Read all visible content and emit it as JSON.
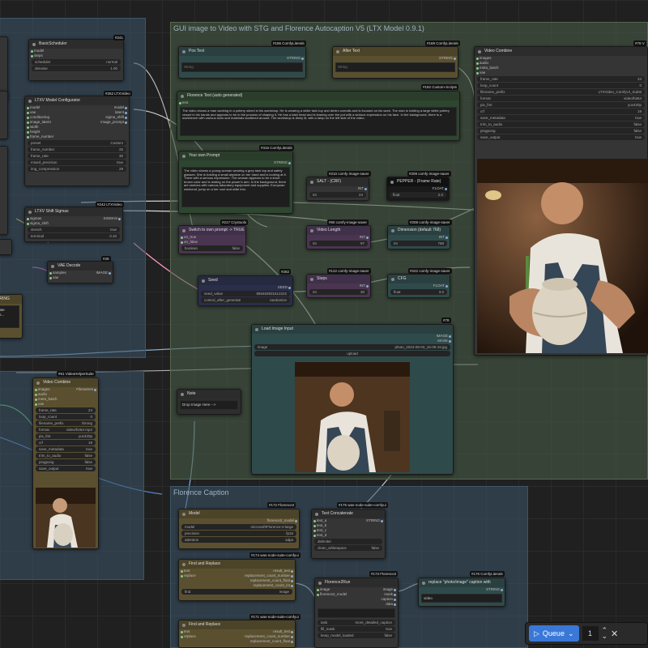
{
  "groups": {
    "autocaption": "GUI image to Video with STG and Florence Autocaption V5 (LTX Model 0.9.1)",
    "florence": "Florence Caption"
  },
  "nodes": {
    "basic_scheduler": {
      "badge": "#241",
      "title": "BasicScheduler",
      "slots": [
        "model",
        "steps",
        "scheduler",
        "sigmas"
      ],
      "widgets": [
        [
          "scheduler",
          "normal"
        ],
        [
          "denoise",
          "1.00"
        ]
      ]
    },
    "ltxv_config": {
      "badge": "#252 LTXVideo",
      "title": "LTXV Model Configurator",
      "inputs": [
        "model",
        "vae",
        "conditioning",
        "image_latent",
        "width",
        "height",
        "frame_number",
        "img_compression"
      ],
      "outputs": [
        "model",
        "latent",
        "sigma_shift",
        "image_prompt"
      ],
      "widgets": [
        [
          "preset",
          "Custom"
        ],
        [
          "frame_number",
          "25"
        ],
        [
          "frame_rate",
          "30"
        ],
        [
          "mixed_precision",
          "true"
        ],
        [
          "img_compression",
          "29"
        ]
      ]
    },
    "ltxv_shift": {
      "badge": "#242 LTXVideo",
      "title": "LTXV Shift Sigmas",
      "inputs": [
        "sigmas",
        "sigma_shift"
      ],
      "outputs": [
        "SIGMAS"
      ],
      "widgets": [
        [
          "stretch",
          "true"
        ],
        [
          "terminal",
          "0.10"
        ]
      ]
    },
    "vae_decode": {
      "badge": "#28",
      "title": "VAE Decode",
      "inputs": [
        "samples",
        "vae"
      ],
      "outputs": [
        "IMAGE"
      ]
    },
    "pos_text": {
      "badge": "#186 ComfyLiterals",
      "title": "Pos Text",
      "out": "STRING",
      "text": "String"
    },
    "after_text": {
      "badge": "#169 ComfyLiterals",
      "title": "After Text",
      "out": "STRING",
      "text": "String"
    },
    "florence_text": {
      "badge": "#182 Custom-Scripts",
      "title": "Florence Text (auto generated)",
      "in": "text",
      "text": "The video shows a man working in a pottery wheel in his workshop. He is wearing a white tank top and denim overalls and is focused on his work. The man is holding a large white pottery vessel in his hands and appears to be in the process of shaping it. He has a bald head and is leaning over the pot with a serious expression on his face. In the background, there is a workbench with various tools and materials scattered around. The workshop is dimly lit, with a lamp on the left side of the video."
    },
    "own_prompt": {
      "badge": "#316 ComfyLiterals",
      "title": "Your own Prompt",
      "out": "STRING",
      "text": "The video shows a young woman wearing a grey tank top and safety glasses. She is holding a small airplane on her hand and is looking at it. There with a serious expression. The woman appears to be a short brown color and is resting on the power's arm. In the background, there are shelves with various laboratory equipment and supplies. European weekend, jump on a her cool and slide into."
    },
    "salt": {
      "badge": "#210 comfy-image-saver",
      "title": "SALT - (CRF)",
      "out": "INT",
      "widget": [
        "int",
        "24"
      ]
    },
    "pepper": {
      "badge": "#209 comfy-image-saver",
      "title": "PEPPER - (Frame Rate)",
      "out": "FLOAT",
      "widget": [
        "float",
        "2.0"
      ]
    },
    "switch": {
      "badge": "#217 Crystools",
      "title": "Switch to own prompt -> TRUE",
      "inputs": [
        "on_true",
        "on_false"
      ],
      "widget": [
        "boolean",
        "false"
      ]
    },
    "video_length": {
      "badge": "#60 comfy-image-saver",
      "title": "Video Length",
      "out": "INT",
      "widget": [
        "int",
        "97"
      ]
    },
    "dim_res": {
      "badge": "#208 comfy-image-saver",
      "title": "Dimension (default 768)",
      "out": "INT",
      "widget": [
        "int",
        "768"
      ]
    },
    "seed": {
      "badge": "#282",
      "title": "Seed",
      "out": "SEED",
      "widgets": [
        [
          "seed_value",
          "856483931612222"
        ],
        [
          "control_after_generate",
          "randomize"
        ]
      ]
    },
    "steps": {
      "badge": "#122 comfy-image-saver",
      "title": "Steps",
      "out": "INT",
      "widget": [
        "int",
        "30"
      ]
    },
    "cfg": {
      "badge": "#222 comfy-image-saver",
      "title": "CFG",
      "out": "FLOAT",
      "widget": [
        "float",
        "3.0"
      ]
    },
    "video_combine_top": {
      "badge": "#78 V",
      "title": "Video Combine",
      "inputs": [
        "images",
        "audio",
        "meta_batch",
        "vae"
      ],
      "widgets": [
        [
          "frame_rate",
          "24"
        ],
        [
          "loop_count",
          "0"
        ],
        [
          "filename_prefix",
          "LTXVideo_ComfyUI_Subtit"
        ],
        [
          "format",
          "video/h264"
        ],
        [
          "pix_fmt",
          "yuv420p"
        ],
        [
          "crf",
          "19"
        ],
        [
          "save_metadata",
          "true"
        ],
        [
          "trim_to_audio",
          "false"
        ],
        [
          "pingpong",
          "false"
        ],
        [
          "save_output",
          "true"
        ]
      ]
    },
    "load_image": {
      "badge": "#78",
      "title": "Load Image Input",
      "outs": [
        "IMAGE",
        "MASK"
      ],
      "widget": [
        "image",
        "photo_2024-09-03_15-05-19.jpg"
      ],
      "upload": "upload"
    },
    "note": {
      "title": "Note",
      "text": "Drop Image Here -->"
    },
    "video_combine_left": {
      "badge": "#61 VideoHelperSuite",
      "title": "Video Combine",
      "inputs": [
        "images",
        "audio",
        "meta_batch",
        "vae"
      ],
      "out": "Filenames",
      "widgets": [
        [
          "frame_rate",
          "24"
        ],
        [
          "loop_count",
          "0"
        ],
        [
          "filename_prefix",
          "throng"
        ],
        [
          "format",
          "video/h264-mp4"
        ],
        [
          "pix_fmt",
          "yuv420p"
        ],
        [
          "crf",
          "19"
        ],
        [
          "save_metadata",
          "true"
        ],
        [
          "trim_to_audio",
          "false"
        ],
        [
          "pingpong",
          "false"
        ],
        [
          "save_output",
          "true"
        ]
      ]
    },
    "model": {
      "badge": "#172 Florence2",
      "title": "Model",
      "outs": [
        "florence2_model"
      ],
      "widgets": [
        [
          "model",
          "microsoft/Florence-2-large"
        ],
        [
          "precision",
          "fp16"
        ],
        [
          "attention",
          "sdpa"
        ]
      ]
    },
    "text_concat": {
      "badge": "#175 was-node-suite-comfyui",
      "title": "Text Concatenate",
      "inputs": [
        "text_a",
        "text_b",
        "text_c",
        "text_d"
      ],
      "out": "STRING",
      "widgets": [
        [
          "delimiter",
          ""
        ],
        [
          "clean_whitespace",
          "false"
        ]
      ]
    },
    "find_replace1": {
      "badge": "#174 was-node-suite-comfyui",
      "title": "Find and Replace",
      "inputs": [
        "text",
        "replace"
      ],
      "outs": [
        "result_text",
        "replacement_count_number",
        "replacement_count_float",
        "replacement_count_int"
      ],
      "widget": [
        "find",
        "image"
      ]
    },
    "florence_run": {
      "badge": "#173 Florence2",
      "title": "Florence2Run",
      "inputs": [
        "image",
        "florence2_model"
      ],
      "outs": [
        "image",
        "mask",
        "caption",
        "data"
      ],
      "widgets": [
        [
          "task",
          "more_detailed_caption"
        ],
        [
          "fill_mask",
          "true"
        ],
        [
          "keep_model_loaded",
          "false"
        ]
      ]
    },
    "replace_photo": {
      "badge": "#176 ComfyLiterals",
      "title": "replace \"photo/image\" caption with",
      "out": "STRING",
      "text": "video"
    },
    "find_replace2": {
      "badge": "#171 was-node-suite-comfyui",
      "title": "Find and Replace",
      "inputs": [
        "text",
        "replace"
      ],
      "outs": [
        "result_text",
        "replacement_count_number",
        "replacement_count_float"
      ]
    },
    "left_text": {
      "title": "STRING",
      "text": "Generate images..."
    }
  },
  "queue": {
    "label": "Queue",
    "count": "1",
    "chevron": "⌄",
    "up": "⌃",
    "down": "⌄",
    "cancel": "✕"
  },
  "colors": {
    "accent": "#3a78d8",
    "group_blue": "#3c5569",
    "group_green": "#485c46"
  }
}
